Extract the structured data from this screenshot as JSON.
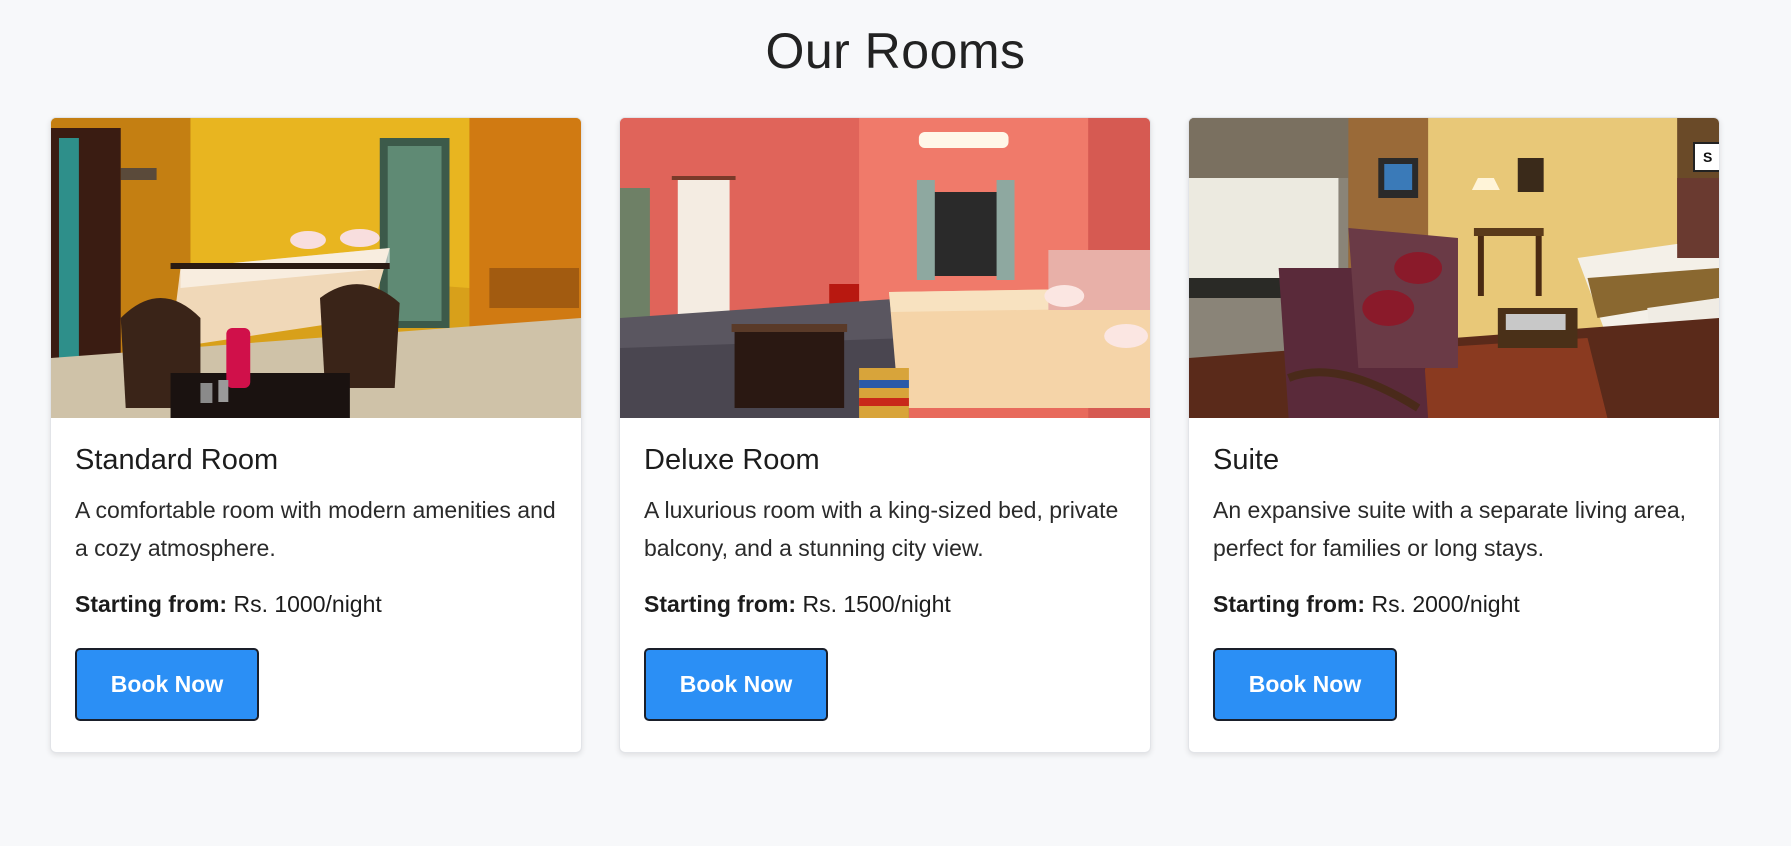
{
  "page": {
    "title": "Our Rooms"
  },
  "rooms": [
    {
      "name": "Standard Room",
      "description": "A comfortable room with modern amenities and a cozy atmosphere.",
      "price_label": "Starting from:",
      "price": "Rs. 1000/night",
      "button_label": "Book Now"
    },
    {
      "name": "Deluxe Room",
      "description": "A luxurious room with a king-sized bed, private balcony, and a stunning city view.",
      "price_label": "Starting from:",
      "price": "Rs. 1500/night",
      "button_label": "Book Now"
    },
    {
      "name": "Suite",
      "description": "An expansive suite with a separate living area, perfect for families or long stays.",
      "price_label": "Starting from:",
      "price": "Rs. 2000/night",
      "button_label": "Book Now",
      "image_sign_text": "S"
    }
  ],
  "colors": {
    "background": "#f7f8fa",
    "button": "#2b8ff5",
    "button_border": "#1a1f2a"
  }
}
